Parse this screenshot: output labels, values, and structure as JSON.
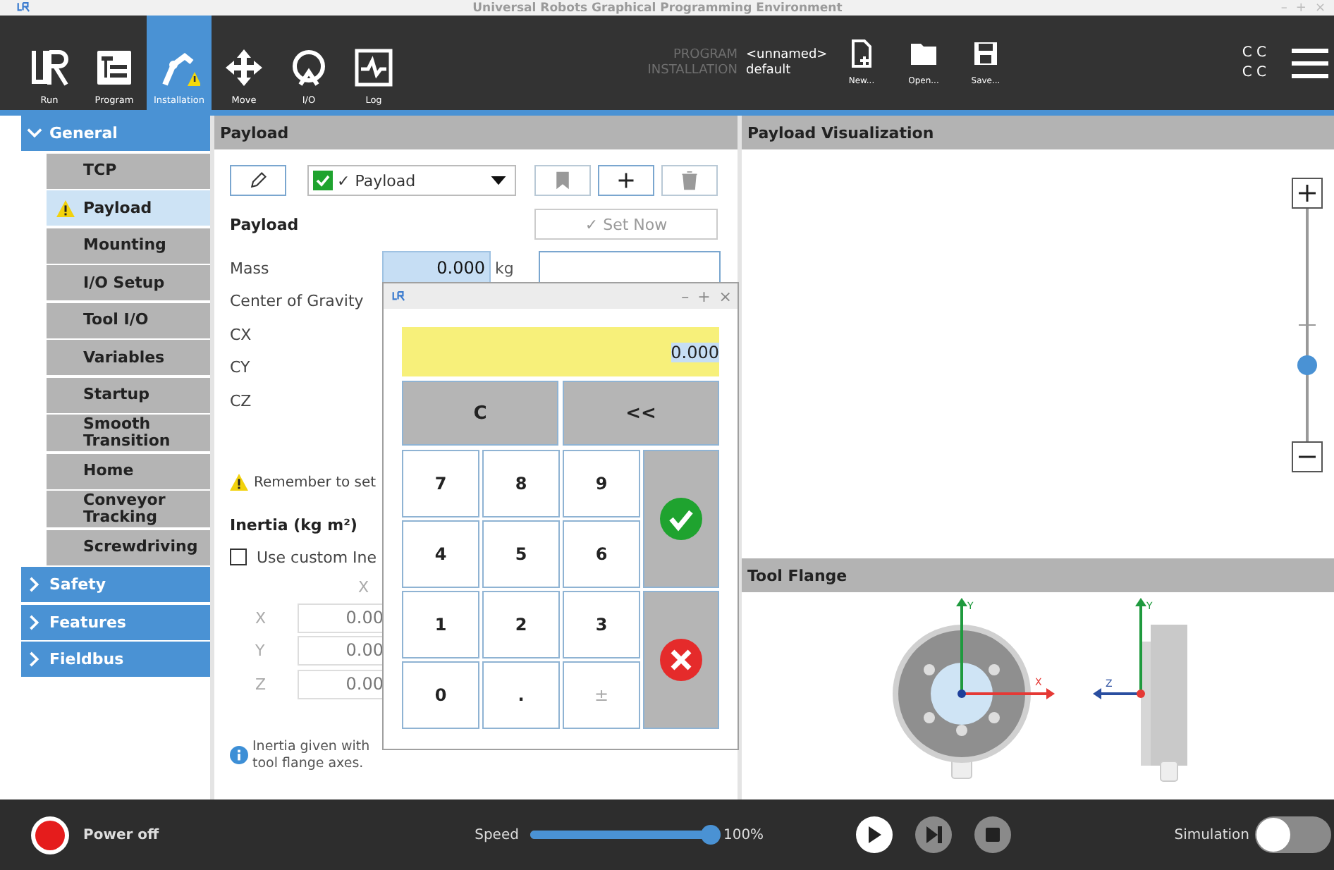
{
  "window": {
    "title": "Universal Robots Graphical Programming Environment",
    "controls": [
      "–",
      "+",
      "×"
    ]
  },
  "nav": [
    {
      "label": "Run",
      "kind": "run",
      "selected": false
    },
    {
      "label": "Program",
      "kind": "program",
      "selected": false
    },
    {
      "label": "Installation",
      "kind": "installation",
      "selected": true
    },
    {
      "label": "Move",
      "kind": "move",
      "selected": false
    },
    {
      "label": "I/O",
      "kind": "io",
      "selected": false
    },
    {
      "label": "Log",
      "kind": "log",
      "selected": false
    }
  ],
  "program": {
    "program_label": "PROGRAM",
    "program_value": "<unnamed>",
    "installation_label": "INSTALLATION",
    "installation_value": "default"
  },
  "file_buttons": [
    {
      "label": "New...",
      "kind": "new"
    },
    {
      "label": "Open...",
      "kind": "open"
    },
    {
      "label": "Save...",
      "kind": "save"
    }
  ],
  "status_text": [
    "C C",
    "C C"
  ],
  "sidebar": {
    "sections": [
      {
        "label": "General",
        "expanded": true,
        "children": [
          {
            "label": "TCP",
            "selected": false,
            "warning": false
          },
          {
            "label": "Payload",
            "selected": true,
            "warning": true
          },
          {
            "label": "Mounting",
            "selected": false,
            "warning": false
          },
          {
            "label": "I/O Setup",
            "selected": false,
            "warning": false
          },
          {
            "label": "Tool I/O",
            "selected": false,
            "warning": false
          },
          {
            "label": "Variables",
            "selected": false,
            "warning": false
          },
          {
            "label": "Startup",
            "selected": false,
            "warning": false
          },
          {
            "label": "Smooth Transition",
            "selected": false,
            "warning": false
          },
          {
            "label": "Home",
            "selected": false,
            "warning": false
          },
          {
            "label": "Conveyor Tracking",
            "selected": false,
            "warning": false
          },
          {
            "label": "Screwdriving",
            "selected": false,
            "warning": false
          }
        ]
      },
      {
        "label": "Safety",
        "expanded": false
      },
      {
        "label": "Features",
        "expanded": false
      },
      {
        "label": "Fieldbus",
        "expanded": false
      }
    ]
  },
  "payload_panel": {
    "title": "Payload",
    "tool_buttons": [
      {
        "kind": "edit",
        "disabled": false
      },
      {
        "kind": "bookmark",
        "disabled": true
      },
      {
        "kind": "add",
        "disabled": false
      },
      {
        "kind": "delete",
        "disabled": true
      }
    ],
    "preset": {
      "label": "✓ Payload",
      "checked": true
    },
    "section_title": "Payload",
    "set_now": {
      "label": "✓ Set Now",
      "disabled": true
    },
    "mass": {
      "label": "Mass",
      "value": "0.000",
      "unit": "kg"
    },
    "cog_label": "Center of Gravity",
    "coords": [
      "CX",
      "CY",
      "CZ"
    ],
    "warning": "Remember to set",
    "inertia_title": "Inertia (kg m²)",
    "custom_inertia": {
      "label": "Use custom Ine",
      "checked": false
    },
    "column_header": "X",
    "inertia_rows": [
      {
        "label": "X",
        "value": "0.00"
      },
      {
        "label": "Y",
        "value": "0.00"
      },
      {
        "label": "Z",
        "value": "0.00"
      }
    ],
    "info": [
      "Inertia given with",
      "tool flange axes."
    ]
  },
  "keypad": {
    "display": "0.000",
    "top_keys": [
      "C",
      "<<"
    ],
    "keys": [
      {
        "label": "7",
        "disabled": false
      },
      {
        "label": "8",
        "disabled": false
      },
      {
        "label": "9",
        "disabled": false
      },
      {
        "label": "4",
        "disabled": false
      },
      {
        "label": "5",
        "disabled": false
      },
      {
        "label": "6",
        "disabled": false
      },
      {
        "label": "1",
        "disabled": false
      },
      {
        "label": "2",
        "disabled": false
      },
      {
        "label": "3",
        "disabled": false
      },
      {
        "label": "0",
        "disabled": false
      },
      {
        "label": ".",
        "disabled": false
      },
      {
        "label": "±",
        "disabled": true
      }
    ]
  },
  "visualization": {
    "title": "Payload Visualization",
    "zoom": {
      "level": 0.31
    }
  },
  "tool_flange": {
    "title": "Tool Flange",
    "axis_labels": [
      "Y",
      "X",
      "Y",
      "Z"
    ]
  },
  "footer": {
    "power": {
      "label": "Power off"
    },
    "speed": {
      "label": "Speed",
      "level": 1,
      "reading": "100%"
    },
    "simulation": {
      "label": "Simulation",
      "on": false
    }
  }
}
